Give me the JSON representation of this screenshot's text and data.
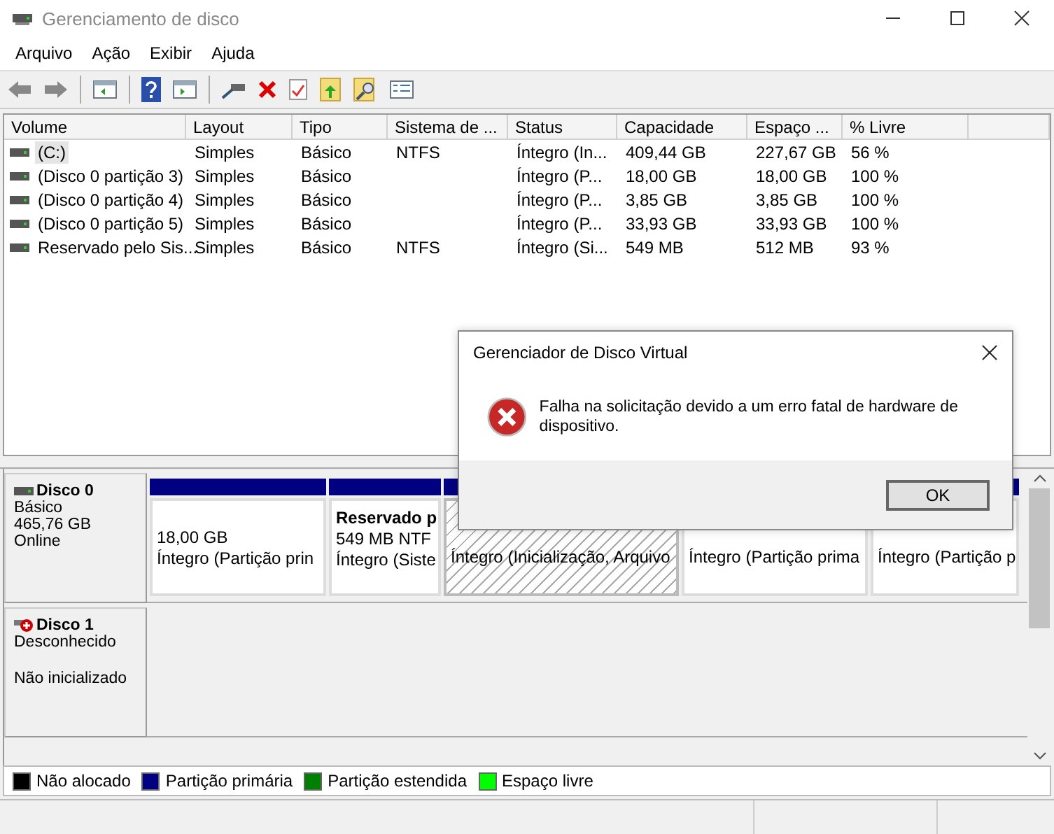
{
  "window": {
    "title": "Gerenciamento de disco"
  },
  "menu": [
    "Arquivo",
    "Ação",
    "Exibir",
    "Ajuda"
  ],
  "volumes_table": {
    "columns": [
      "Volume",
      "Layout",
      "Tipo",
      "Sistema de ...",
      "Status",
      "Capacidade",
      "Espaço ...",
      "% Livre"
    ],
    "rows": [
      {
        "selected": true,
        "cells": [
          "(C:)",
          "Simples",
          "Básico",
          "NTFS",
          "Íntegro (In...",
          "409,44 GB",
          "227,67 GB",
          "56 %"
        ]
      },
      {
        "selected": false,
        "cells": [
          "(Disco 0 partição 3)",
          "Simples",
          "Básico",
          "",
          "Íntegro (P...",
          "18,00 GB",
          "18,00 GB",
          "100 %"
        ]
      },
      {
        "selected": false,
        "cells": [
          "(Disco 0 partição 4)",
          "Simples",
          "Básico",
          "",
          "Íntegro (P...",
          "3,85 GB",
          "3,85 GB",
          "100 %"
        ]
      },
      {
        "selected": false,
        "cells": [
          "(Disco 0 partição 5)",
          "Simples",
          "Básico",
          "",
          "Íntegro (P...",
          "33,93 GB",
          "33,93 GB",
          "100 %"
        ]
      },
      {
        "selected": false,
        "cells": [
          "Reservado pelo Sis...",
          "Simples",
          "Básico",
          "NTFS",
          "Íntegro (Si...",
          "549 MB",
          "512 MB",
          "93 %"
        ]
      }
    ]
  },
  "disks": [
    {
      "name": "Disco 0",
      "kind": "online",
      "type": "Básico",
      "size": "465,76 GB",
      "state": "Online",
      "partitions": [
        {
          "selected": false,
          "size": "18,00 GB",
          "status": "Íntegro (Partição prin"
        },
        {
          "selected": false,
          "name": "Reservado p",
          "size": "549 MB NTF",
          "status": "Íntegro (Siste"
        },
        {
          "selected": true,
          "status": "Íntegro (Inicialização, Arquivo"
        },
        {
          "selected": false,
          "status": "Íntegro (Partição prima"
        },
        {
          "selected": false,
          "status": "Íntegro (Partição p"
        }
      ]
    },
    {
      "name": "Disco 1",
      "kind": "error",
      "type": "Desconhecido",
      "state": "Não inicializado"
    }
  ],
  "legend": [
    {
      "label": "Não alocado",
      "color": "#000000"
    },
    {
      "label": "Partição primária",
      "color": "#000080"
    },
    {
      "label": "Partição estendida",
      "color": "#008000"
    },
    {
      "label": "Espaço livre",
      "color": "#00ff00"
    }
  ],
  "dialog": {
    "title": "Gerenciador de Disco Virtual",
    "message": "Falha na solicitação devido a um erro fatal de hardware de dispositivo.",
    "button": "OK"
  }
}
